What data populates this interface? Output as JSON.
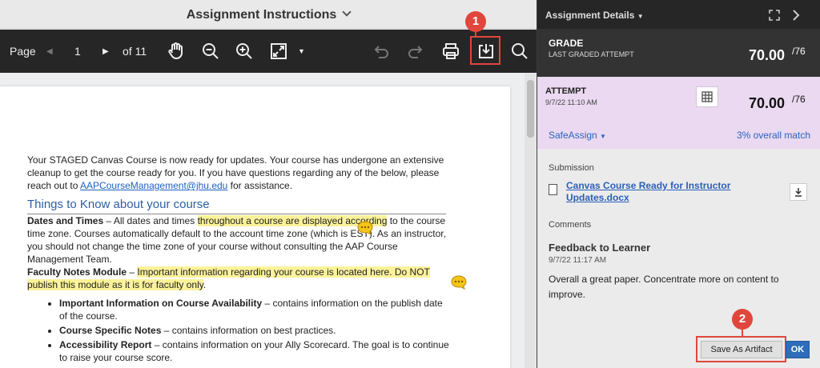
{
  "viewer": {
    "title": "Assignment Instructions",
    "toolbar": {
      "page_label": "Page",
      "page_number": "1",
      "page_count": "of 11"
    },
    "document": {
      "intro_1": "Your STAGED Canvas Course is now ready for updates. Your course has undergone an extensive cleanup to get the course ready for you. If you have questions regarding any of the below, please reach out to ",
      "intro_email": "AAPCourseManagement@jhu.edu",
      "intro_2": " for assistance.",
      "heading": "Things to Know about your course",
      "dt_label": "Dates and Times",
      "dt_1": " – All dates and times ",
      "dt_hl": "throughout a course are displayed according",
      "dt_2": " to the course time zone. Courses automatically default to the account time zone (which is EST). As an instructor, you should not change the time zone of your course without consulting the AAP Course Management Team.",
      "fm_label": "Faculty Notes Module",
      "fm_1": " – ",
      "fm_hl": "Important information regarding your course is located here. Do NOT publish this module as it is for faculty only",
      "fm_2": ".",
      "bullets": [
        {
          "bold": "Important Information on Course Availability",
          "text": " – contains information on the publish date of the course."
        },
        {
          "bold": "Course Specific Notes",
          "text": " – contains information on best practices."
        },
        {
          "bold": "Accessibility Report",
          "text": " – contains information on your Ally Scorecard. The goal is to continue to raise your course score."
        }
      ]
    }
  },
  "callouts": {
    "one": "1",
    "two": "2"
  },
  "panel": {
    "title": "Assignment Details",
    "grade": {
      "label": "GRADE",
      "sub": "LAST GRADED ATTEMPT",
      "score": "70.00",
      "out_of": "/76"
    },
    "attempt": {
      "label": "ATTEMPT",
      "date": "9/7/22 11:10 AM",
      "score": "70.00",
      "out_of": "/76"
    },
    "safeassign": {
      "label": "SafeAssign",
      "match": "3% overall match"
    },
    "submission": {
      "label": "Submission",
      "file": "Canvas Course Ready for Instructor Updates.docx"
    },
    "comments": {
      "label": "Comments",
      "title": "Feedback to Learner",
      "date": "9/7/22 11:17 AM",
      "text": "Overall a great paper. Concentrate more on content to improve."
    },
    "buttons": {
      "save": "Save As Artifact",
      "ok": "OK"
    }
  },
  "colors": {
    "accent_red": "#e1463c",
    "link_blue": "#2b63c2",
    "highlight": "#fbf29a",
    "attempt_bg": "#ead9f0"
  }
}
